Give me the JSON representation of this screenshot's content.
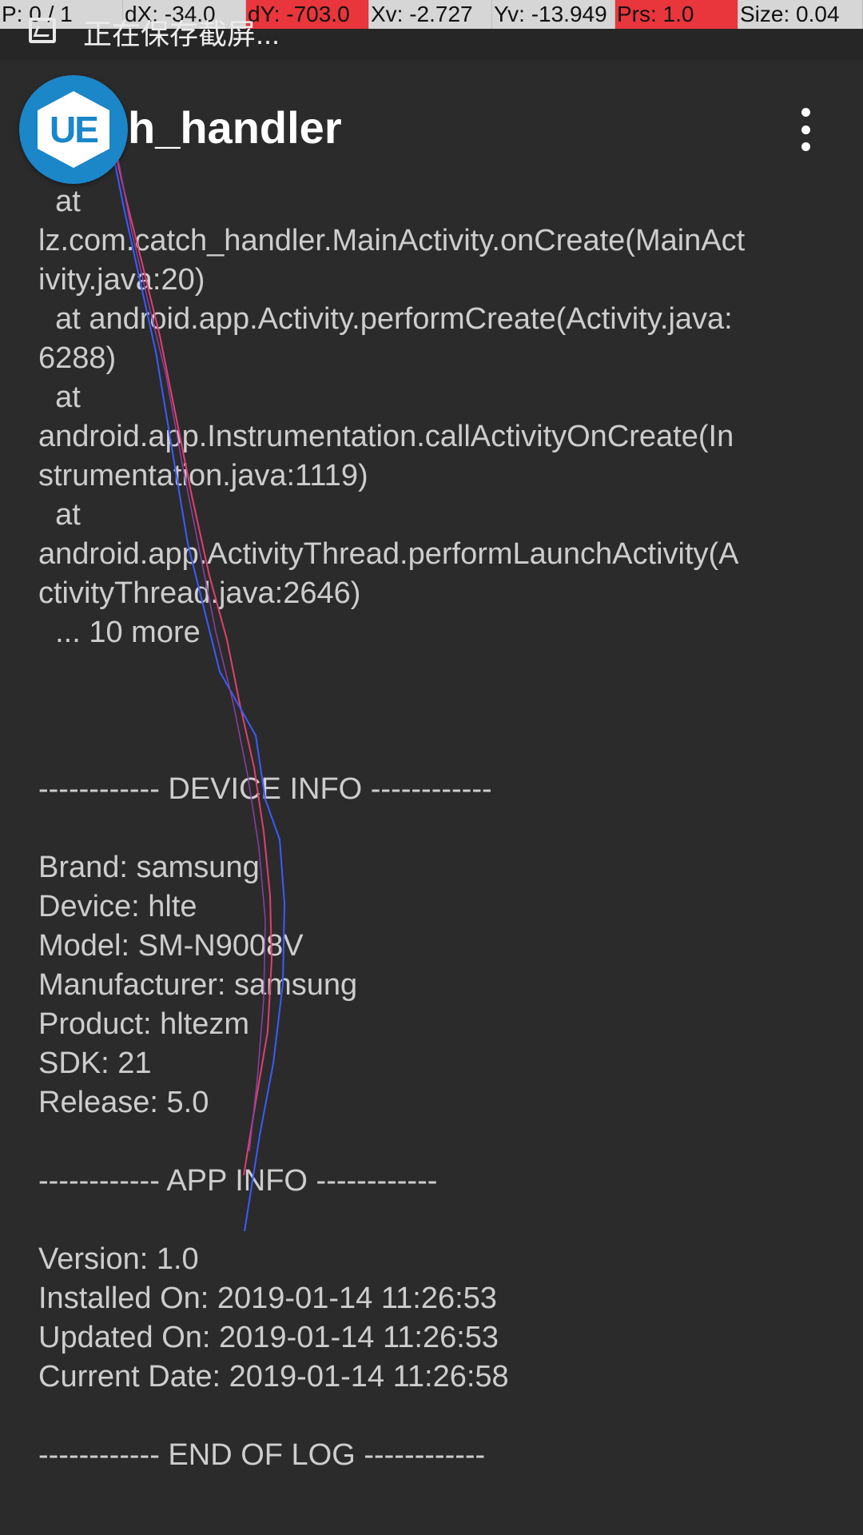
{
  "debug": {
    "pointer": "P: 0 / 1",
    "dx": "dX: -34.0",
    "dy": "dY: -703.0",
    "xv": "Xv: -2.727",
    "yv": "Yv: -13.949",
    "prs": "Prs: 1.0",
    "size": "Size: 0.04"
  },
  "status": {
    "text": "正在保存截屏...",
    "icon": "screenshot-icon"
  },
  "toolbar": {
    "title_visible": "h_handler",
    "menu_icon": "more-vert-icon"
  },
  "badge": {
    "label": "UE"
  },
  "log_lines": [
    "  at",
    "lz.com.catch_handler.MainActivity.onCreate(MainAct",
    "ivity.java:20)",
    "  at android.app.Activity.performCreate(Activity.java:",
    "6288)",
    "  at",
    "android.app.Instrumentation.callActivityOnCreate(In",
    "strumentation.java:1119)",
    "  at",
    "android.app.ActivityThread.performLaunchActivity(A",
    "ctivityThread.java:2646)",
    "  ... 10 more",
    "",
    "",
    "",
    "------------ DEVICE INFO ------------",
    "",
    "Brand: samsung",
    "Device: hlte",
    "Model: SM-N9008V",
    "Manufacturer: samsung",
    "Product: hltezm",
    "SDK: 21",
    "Release: 5.0",
    "",
    "------------ APP INFO ------------",
    "",
    "Version: 1.0",
    "Installed On: 2019-01-14 11:26:53",
    "Updated On: 2019-01-14 11:26:53",
    "Current Date: 2019-01-14 11:26:58",
    "",
    "------------ END OF LOG ------------"
  ],
  "colors": {
    "background": "#2b2b2b",
    "log_text": "#cdcdcd",
    "badge": "#1b86c8",
    "debug_alert": "#e8363c"
  }
}
